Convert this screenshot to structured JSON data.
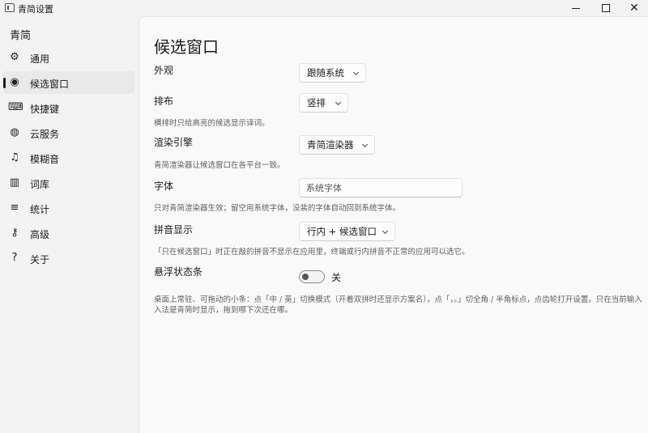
{
  "window": {
    "title": "青简设置",
    "close_glyph": "✕"
  },
  "sidebar": {
    "title": "青简",
    "items": [
      {
        "label": "通用",
        "icon": "⚙"
      },
      {
        "label": "候选窗口",
        "icon": "◉"
      },
      {
        "label": "快捷键",
        "icon": "⌨"
      },
      {
        "label": "云服务",
        "icon": "◍"
      },
      {
        "label": "模糊音",
        "icon": "♫"
      },
      {
        "label": "词库",
        "icon": "▥"
      },
      {
        "label": "统计",
        "icon": "≡"
      },
      {
        "label": "高级",
        "icon": "⚷"
      },
      {
        "label": "关于",
        "icon": "?"
      }
    ],
    "active_index": 1
  },
  "page": {
    "title": "候选窗口",
    "appearance": {
      "label": "外观",
      "value": "跟随系统"
    },
    "layout": {
      "label": "排布",
      "value": "竖排",
      "desc": "横排时只给高亮的候选显示译词。"
    },
    "engine": {
      "label": "渲染引擎",
      "value": "青简渲染器",
      "desc": "青简渲染器让候选窗口在各平台一致。"
    },
    "font": {
      "label": "字体",
      "placeholder": "系统字体",
      "desc": "只对青简渲染器生效；留空用系统字体，没装的字体自动回到系统字体。"
    },
    "pinyin": {
      "label": "拼音显示",
      "value": "行内 + 候选窗口",
      "desc": "「只在候选窗口」时正在敲的拼音不显示在应用里，终端或行内拼音不正常的应用可以选它。"
    },
    "floating": {
      "label": "悬浮状态条",
      "state": "关",
      "desc1": "桌面上常驻、可拖动的小条：点「中 / 英」切换模式（开着双拼时还显示方案名），点「，。」切全角 / 半角标点，点齿轮打开设置。只在当前输入",
      "desc2": "入法是青简时显示，拖到哪下次还在哪。"
    }
  }
}
